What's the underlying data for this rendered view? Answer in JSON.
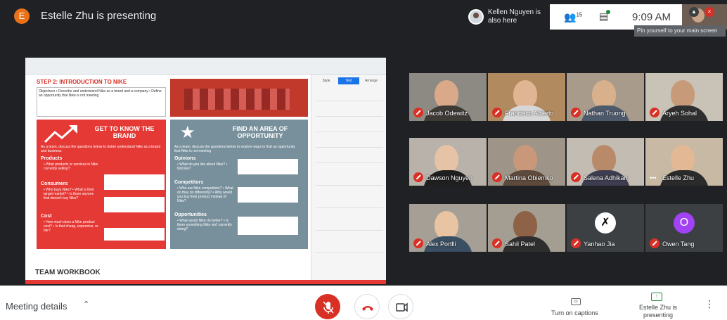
{
  "topbar": {
    "presenter_initial": "E",
    "presenting_title": "Estelle Zhu is presenting",
    "also_here": "Kellen Nguyen is also here",
    "people_count": "15",
    "clock": "9:09 AM",
    "self_tooltip": "Pin yourself to your main screen"
  },
  "slide": {
    "step_title": "STEP 2: INTRODUCTION TO NIKE",
    "objectives": "Objectives • Describe and understand Nike as a brand and a company • Define an opportunity that Nike is not meeting",
    "brand_heading": "GET TO KNOW THE BRAND",
    "opportunity_heading": "FIND AN AREA OF OPPORTUNITY",
    "brand_intro": "As a team, discuss the questions below to better understand Nike as a brand and business",
    "opportunity_intro": "As a team, discuss the questions below to explore ways to find an opportunity that Nike is not meeting",
    "brand_sections": [
      {
        "title": "Products",
        "items": "• What products or services is Nike currently selling?"
      },
      {
        "title": "Consumers",
        "items": "• Who buys Nike? • What is their target market? • Is there anyone that doesn't buy Nike?"
      },
      {
        "title": "Cost",
        "items": "• How much does a Nike product cost? • Is that cheap, expensive, or fair?"
      }
    ],
    "opportunity_sections": [
      {
        "title": "Opinions",
        "items": "• What do you like about Nike? • Not like?"
      },
      {
        "title": "Competitors",
        "items": "• Who are Nike competitors? • What do they do differently? • Why would you buy their product instead of Nike?"
      },
      {
        "title": "Opportunities",
        "items": "• What would Nike do better? • Is there something Nike isn't currently doing?"
      }
    ],
    "team_workbook": "TEAM WORKBOOK",
    "side_tabs": [
      "Style",
      "Text",
      "Arrange"
    ]
  },
  "participants": [
    {
      "name": "Jacob Odewitz",
      "muted": true
    },
    {
      "name": "Francisco Alberto",
      "muted": true
    },
    {
      "name": "Nathan Truong",
      "muted": true
    },
    {
      "name": "Aryeh Sohal",
      "muted": true
    },
    {
      "name": "Dawson Nguyen",
      "muted": true
    },
    {
      "name": "Martina Obiemko",
      "muted": true
    },
    {
      "name": "Salena Adhikari",
      "muted": true
    },
    {
      "name": "Estelle Zhu",
      "muted": false
    },
    {
      "name": "Alex Portlli",
      "muted": true
    },
    {
      "name": "Sahil Patel",
      "muted": true
    },
    {
      "name": "Yanhao Jia",
      "muted": true
    },
    {
      "name": "Owen Tang",
      "muted": true
    }
  ],
  "avatars": {
    "owen_initial": "O"
  },
  "bottombar": {
    "meeting_details": "Meeting details",
    "captions": "Turn on captions",
    "presenting": "Estelle Zhu is presenting"
  },
  "colors": {
    "accent_red": "#d93025",
    "presenting_green": "#1e8e3e",
    "background": "#202124"
  }
}
